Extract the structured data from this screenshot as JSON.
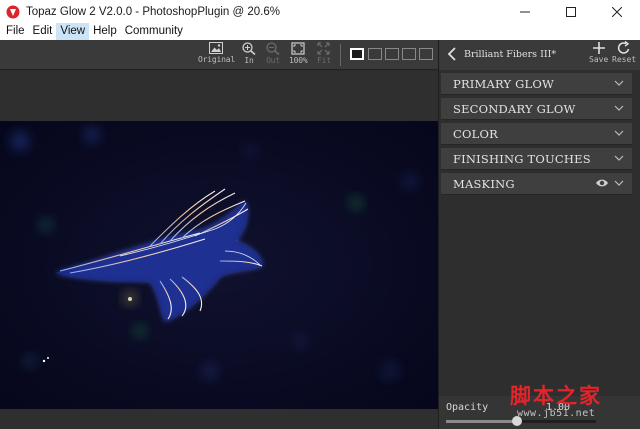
{
  "window": {
    "title": "Topaz Glow 2 V2.0.0 - PhotoshopPlugin @ 20.6%"
  },
  "menu": {
    "items": [
      "File",
      "Edit",
      "View",
      "Help",
      "Community"
    ],
    "active": "View"
  },
  "toolbar": {
    "original": "Original",
    "zoom_in": "In",
    "zoom_out": "Out",
    "zoom_100": "100%",
    "fit": "Fit"
  },
  "panel": {
    "preset_name": "Brilliant Fibers III*",
    "save_label": "Save",
    "reset_label": "Reset",
    "sections": [
      {
        "title": "PRIMARY GLOW"
      },
      {
        "title": "SECONDARY GLOW"
      },
      {
        "title": "COLOR"
      },
      {
        "title": "FINISHING TOUCHES"
      },
      {
        "title": "MASKING"
      }
    ],
    "opacity": {
      "label": "Opacity",
      "value": 0.47,
      "display": "1.00"
    }
  },
  "watermark": {
    "logo": "脚本之家",
    "url": "www.jb51.net"
  },
  "colors": {
    "accent_red": "#e0252b",
    "panel_bg": "#2e2e2e",
    "section_bg": "#3f3f3f",
    "toolbar_bg": "#3a3a3a"
  }
}
